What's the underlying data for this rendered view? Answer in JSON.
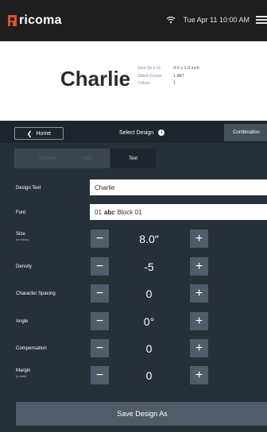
{
  "brand": {
    "logo_text": "ricoma"
  },
  "status": {
    "datetime": "Tue Apr 11  10:00 AM",
    "wifi_icon": "wifi-icon",
    "menu_icon": "hamburger-menu-icon"
  },
  "preview": {
    "name": "Charlie",
    "specs": [
      {
        "label": "Size (w x h)",
        "value": "4.0 x 1.0 inch"
      },
      {
        "label": "Stitch Count",
        "value": "1,887"
      },
      {
        "label": "Colors",
        "value": "1"
      }
    ]
  },
  "nav": {
    "home_label": "Home",
    "title": "Select Design",
    "combination_label": "Combination"
  },
  "tabs": [
    {
      "label": "Machine",
      "active": false
    },
    {
      "label": "USB",
      "active": false
    },
    {
      "label": "Text",
      "active": true
    }
  ],
  "form": {
    "design_text": {
      "label": "Design Text",
      "value": "Charlie"
    },
    "font": {
      "label": "Font",
      "prefix": "01",
      "abc": "abc",
      "name": "Block 01"
    },
    "size": {
      "label": "Size",
      "sublabel": "(in inches)",
      "value": "8.0″"
    },
    "density": {
      "label": "Density",
      "value": "-5"
    },
    "character_spacing": {
      "label": "Character Spacing",
      "value": "0"
    },
    "angle": {
      "label": "Angle",
      "value": "0°"
    },
    "compensation": {
      "label": "Compensation",
      "value": "0"
    },
    "margin": {
      "label": "Margin",
      "sublabel": "(in pixel)",
      "value": "0"
    }
  },
  "stepper": {
    "minus": "−",
    "plus": "+"
  },
  "save_label": "Save Design As",
  "colors": {
    "topbar": "#1e1e1e",
    "brand": "#d9542b",
    "panel": "#272f39",
    "button": "#505c69"
  }
}
